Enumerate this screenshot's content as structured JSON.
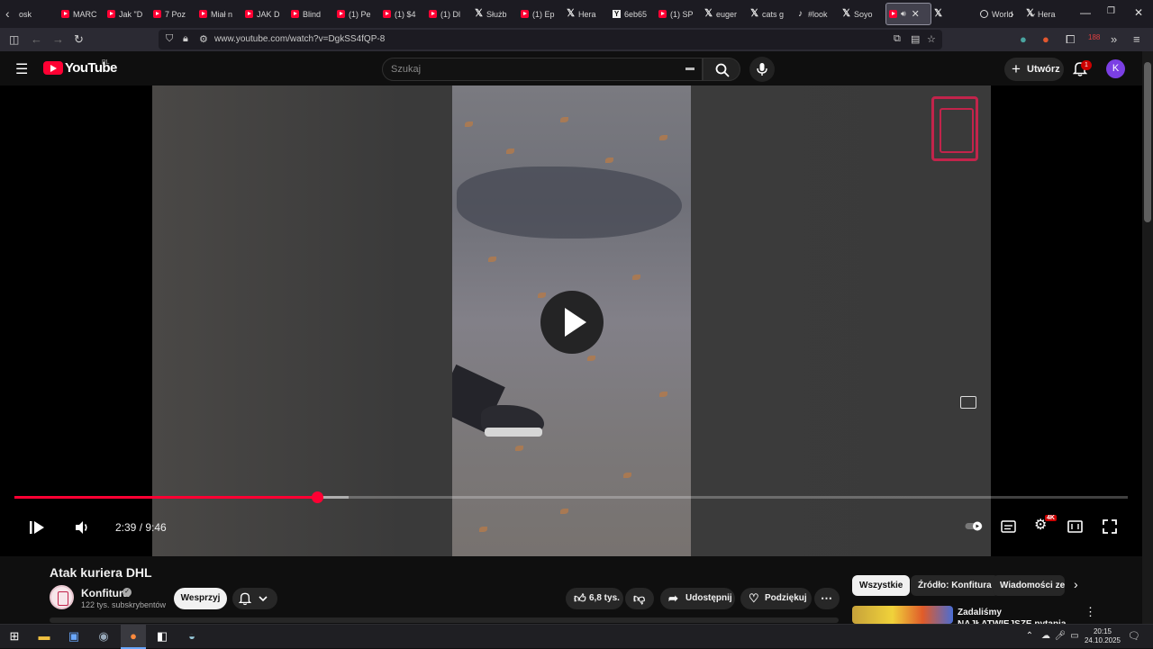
{
  "browser": {
    "tabs": [
      {
        "icon": "partial",
        "title": "osk"
      },
      {
        "icon": "youtube",
        "title": "MARC"
      },
      {
        "icon": "youtube",
        "title": "Jak \"D"
      },
      {
        "icon": "youtube",
        "title": "7 Poz"
      },
      {
        "icon": "youtube",
        "title": "Miał n"
      },
      {
        "icon": "youtube",
        "title": "JAK D"
      },
      {
        "icon": "youtube",
        "title": "Blind"
      },
      {
        "icon": "youtube",
        "title": "(1) Pe"
      },
      {
        "icon": "youtube",
        "title": "(1) $4"
      },
      {
        "icon": "youtube",
        "title": "(1) Dl"
      },
      {
        "icon": "x",
        "title": "Służb"
      },
      {
        "icon": "youtube",
        "title": "(1) Ep"
      },
      {
        "icon": "x",
        "title": "Hera"
      },
      {
        "icon": "ycombinator",
        "title": "6eb65"
      },
      {
        "icon": "youtube",
        "title": "(1) SP"
      },
      {
        "icon": "x",
        "title": "euger"
      },
      {
        "icon": "x",
        "title": "cats g"
      },
      {
        "icon": "tiktok",
        "title": "#look"
      },
      {
        "icon": "x",
        "title": "Soyo"
      }
    ],
    "after_active_tabs": [
      {
        "icon": "x",
        "title": ""
      },
      {
        "icon": "globe",
        "title": "World"
      },
      {
        "icon": "x",
        "title": "Hera"
      }
    ],
    "url": "www.youtube.com/watch?v=DgkSS4fQP-8",
    "extension_badge": "188"
  },
  "youtube": {
    "logo_text": "YouTube",
    "country_code": "PL",
    "search_placeholder": "Szukaj",
    "create_label": "Utwórz",
    "notification_count": "1",
    "avatar_letter": "K"
  },
  "player": {
    "time_display": "2:39 / 9:46",
    "progress_fraction": 0.272,
    "buffer_fraction": 0.3,
    "quality_badge": "4K"
  },
  "video": {
    "title": "Atak kuriera DHL",
    "channel_name": "Konfitura",
    "subscribers": "122 tys. subskrybentów",
    "join_label": "Wesprzyj",
    "likes": "6,8 tys.",
    "share_label": "Udostępnij",
    "thanks_label": "Podziękuj"
  },
  "sidebar": {
    "chips": [
      "Wszystkie",
      "Źródło: Konfitura",
      "Wiadomości ze"
    ],
    "suggestion_title": "Zadaliśmy NAJŁATWIEJSZE pytania na czas!"
  },
  "taskbar": {
    "time": "20:15",
    "date": "24.10.2025"
  },
  "colors": {
    "youtube_red": "#ff0033",
    "page_bg": "#0f0f0f",
    "avatar_purple": "#7b3fe4"
  }
}
